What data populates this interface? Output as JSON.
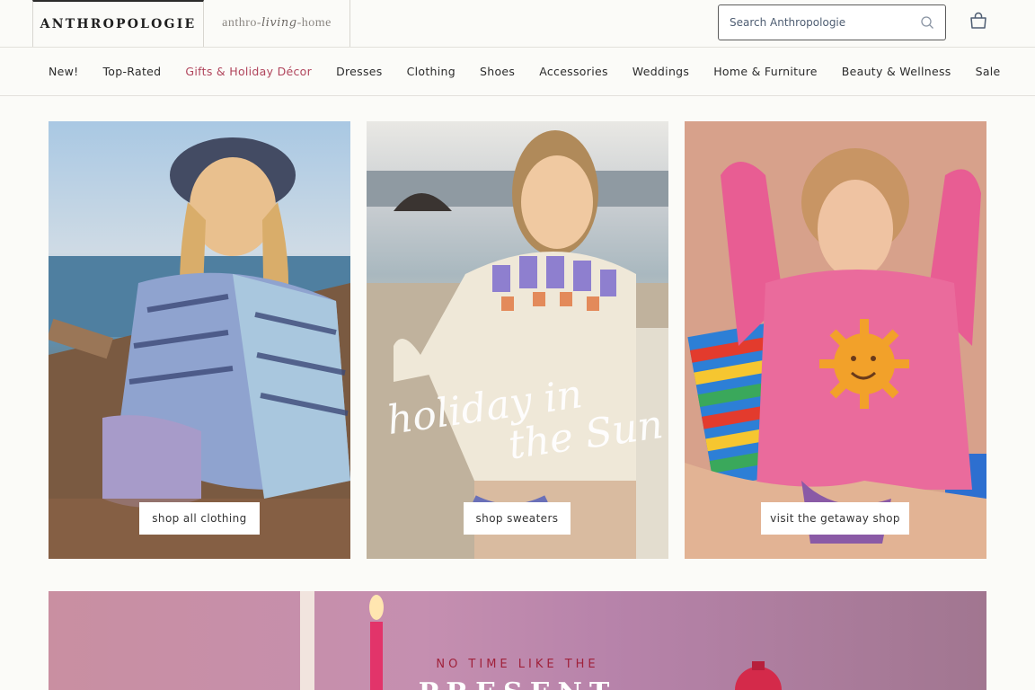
{
  "brand": {
    "primary": "ANTHROPOLOGIE",
    "secondary_pre": "anthro",
    "secondary_script": "living",
    "secondary_post": "home"
  },
  "search": {
    "placeholder": "Search Anthropologie",
    "icon": "search-icon"
  },
  "cart": {
    "icon": "shopping-bag-icon"
  },
  "nav": {
    "items": [
      {
        "label": "New!"
      },
      {
        "label": "Top-Rated"
      },
      {
        "label": "Gifts & Holiday Décor",
        "highlight": true
      },
      {
        "label": "Dresses"
      },
      {
        "label": "Clothing"
      },
      {
        "label": "Shoes"
      },
      {
        "label": "Accessories"
      },
      {
        "label": "Weddings"
      },
      {
        "label": "Home & Furniture"
      },
      {
        "label": "Beauty & Wellness"
      },
      {
        "label": "Sale"
      }
    ]
  },
  "hero": {
    "tiles": [
      {
        "button": "shop all clothing"
      },
      {
        "button": "shop sweaters",
        "script_line1": "holiday in",
        "script_line2": "the Sun"
      },
      {
        "button": "visit the getaway shop"
      }
    ]
  },
  "banner": {
    "kicker": "NO TIME LIKE THE",
    "title": "PRESENT"
  },
  "colors": {
    "accent": "#b0455c",
    "banner_kicker": "#a0223b"
  }
}
